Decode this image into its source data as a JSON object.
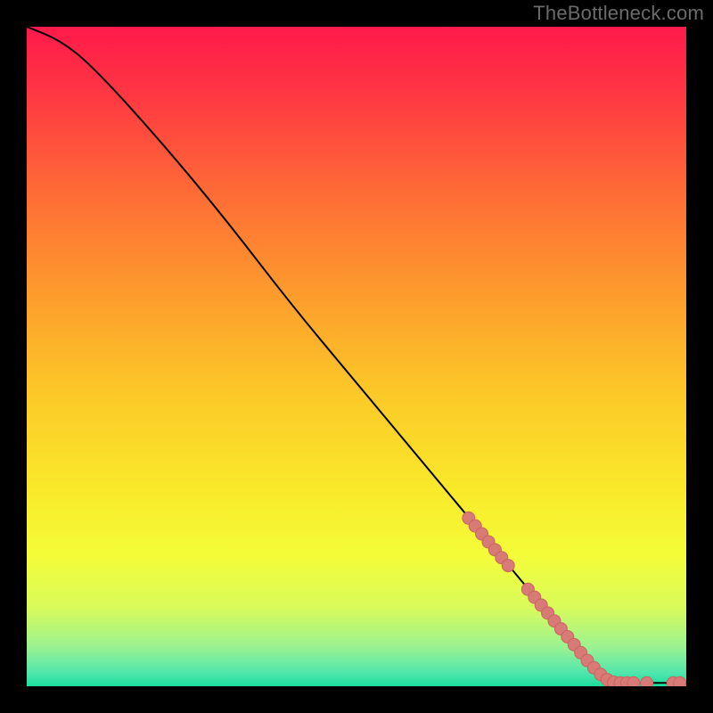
{
  "watermark": "TheBottleneck.com",
  "chart_data": {
    "type": "line",
    "title": "",
    "xlabel": "",
    "ylabel": "",
    "xlim": [
      0,
      100
    ],
    "ylim": [
      0,
      100
    ],
    "curve": [
      {
        "x": 0,
        "y": 100
      },
      {
        "x": 5,
        "y": 98
      },
      {
        "x": 10,
        "y": 94
      },
      {
        "x": 20,
        "y": 83
      },
      {
        "x": 30,
        "y": 71
      },
      {
        "x": 40,
        "y": 58
      },
      {
        "x": 50,
        "y": 46
      },
      {
        "x": 60,
        "y": 34
      },
      {
        "x": 70,
        "y": 22
      },
      {
        "x": 80,
        "y": 10
      },
      {
        "x": 85,
        "y": 4
      },
      {
        "x": 88,
        "y": 1
      },
      {
        "x": 90,
        "y": 0.5
      },
      {
        "x": 100,
        "y": 0.5
      }
    ],
    "points": [
      {
        "x": 67,
        "y": 25.5
      },
      {
        "x": 68,
        "y": 24.3
      },
      {
        "x": 69,
        "y": 23.1
      },
      {
        "x": 70,
        "y": 21.9
      },
      {
        "x": 71,
        "y": 20.7
      },
      {
        "x": 72,
        "y": 19.5
      },
      {
        "x": 73,
        "y": 18.3
      },
      {
        "x": 76,
        "y": 14.7
      },
      {
        "x": 77,
        "y": 13.5
      },
      {
        "x": 78,
        "y": 12.3
      },
      {
        "x": 79,
        "y": 11.1
      },
      {
        "x": 80,
        "y": 9.9
      },
      {
        "x": 81,
        "y": 8.7
      },
      {
        "x": 82,
        "y": 7.5
      },
      {
        "x": 83,
        "y": 6.3
      },
      {
        "x": 84,
        "y": 5.1
      },
      {
        "x": 85,
        "y": 3.9
      },
      {
        "x": 86,
        "y": 2.8
      },
      {
        "x": 87,
        "y": 1.8
      },
      {
        "x": 88,
        "y": 1.0
      },
      {
        "x": 89,
        "y": 0.6
      },
      {
        "x": 90,
        "y": 0.5
      },
      {
        "x": 91,
        "y": 0.5
      },
      {
        "x": 92,
        "y": 0.5
      },
      {
        "x": 94,
        "y": 0.5
      },
      {
        "x": 98,
        "y": 0.5
      },
      {
        "x": 99,
        "y": 0.5
      }
    ],
    "gradient_stops": [
      {
        "offset": 0.0,
        "color": "#ff1a4b"
      },
      {
        "offset": 0.1,
        "color": "#ff3643"
      },
      {
        "offset": 0.25,
        "color": "#fe6b36"
      },
      {
        "offset": 0.4,
        "color": "#fd9a2d"
      },
      {
        "offset": 0.55,
        "color": "#fcc728"
      },
      {
        "offset": 0.7,
        "color": "#f9e92a"
      },
      {
        "offset": 0.8,
        "color": "#f4fc38"
      },
      {
        "offset": 0.88,
        "color": "#d9fb5a"
      },
      {
        "offset": 0.94,
        "color": "#9cf291"
      },
      {
        "offset": 0.98,
        "color": "#4fe6ac"
      },
      {
        "offset": 1.0,
        "color": "#1adf9d"
      }
    ],
    "point_fill": "#d87a75",
    "point_stroke": "#c96560",
    "line_stroke": "#000000"
  }
}
